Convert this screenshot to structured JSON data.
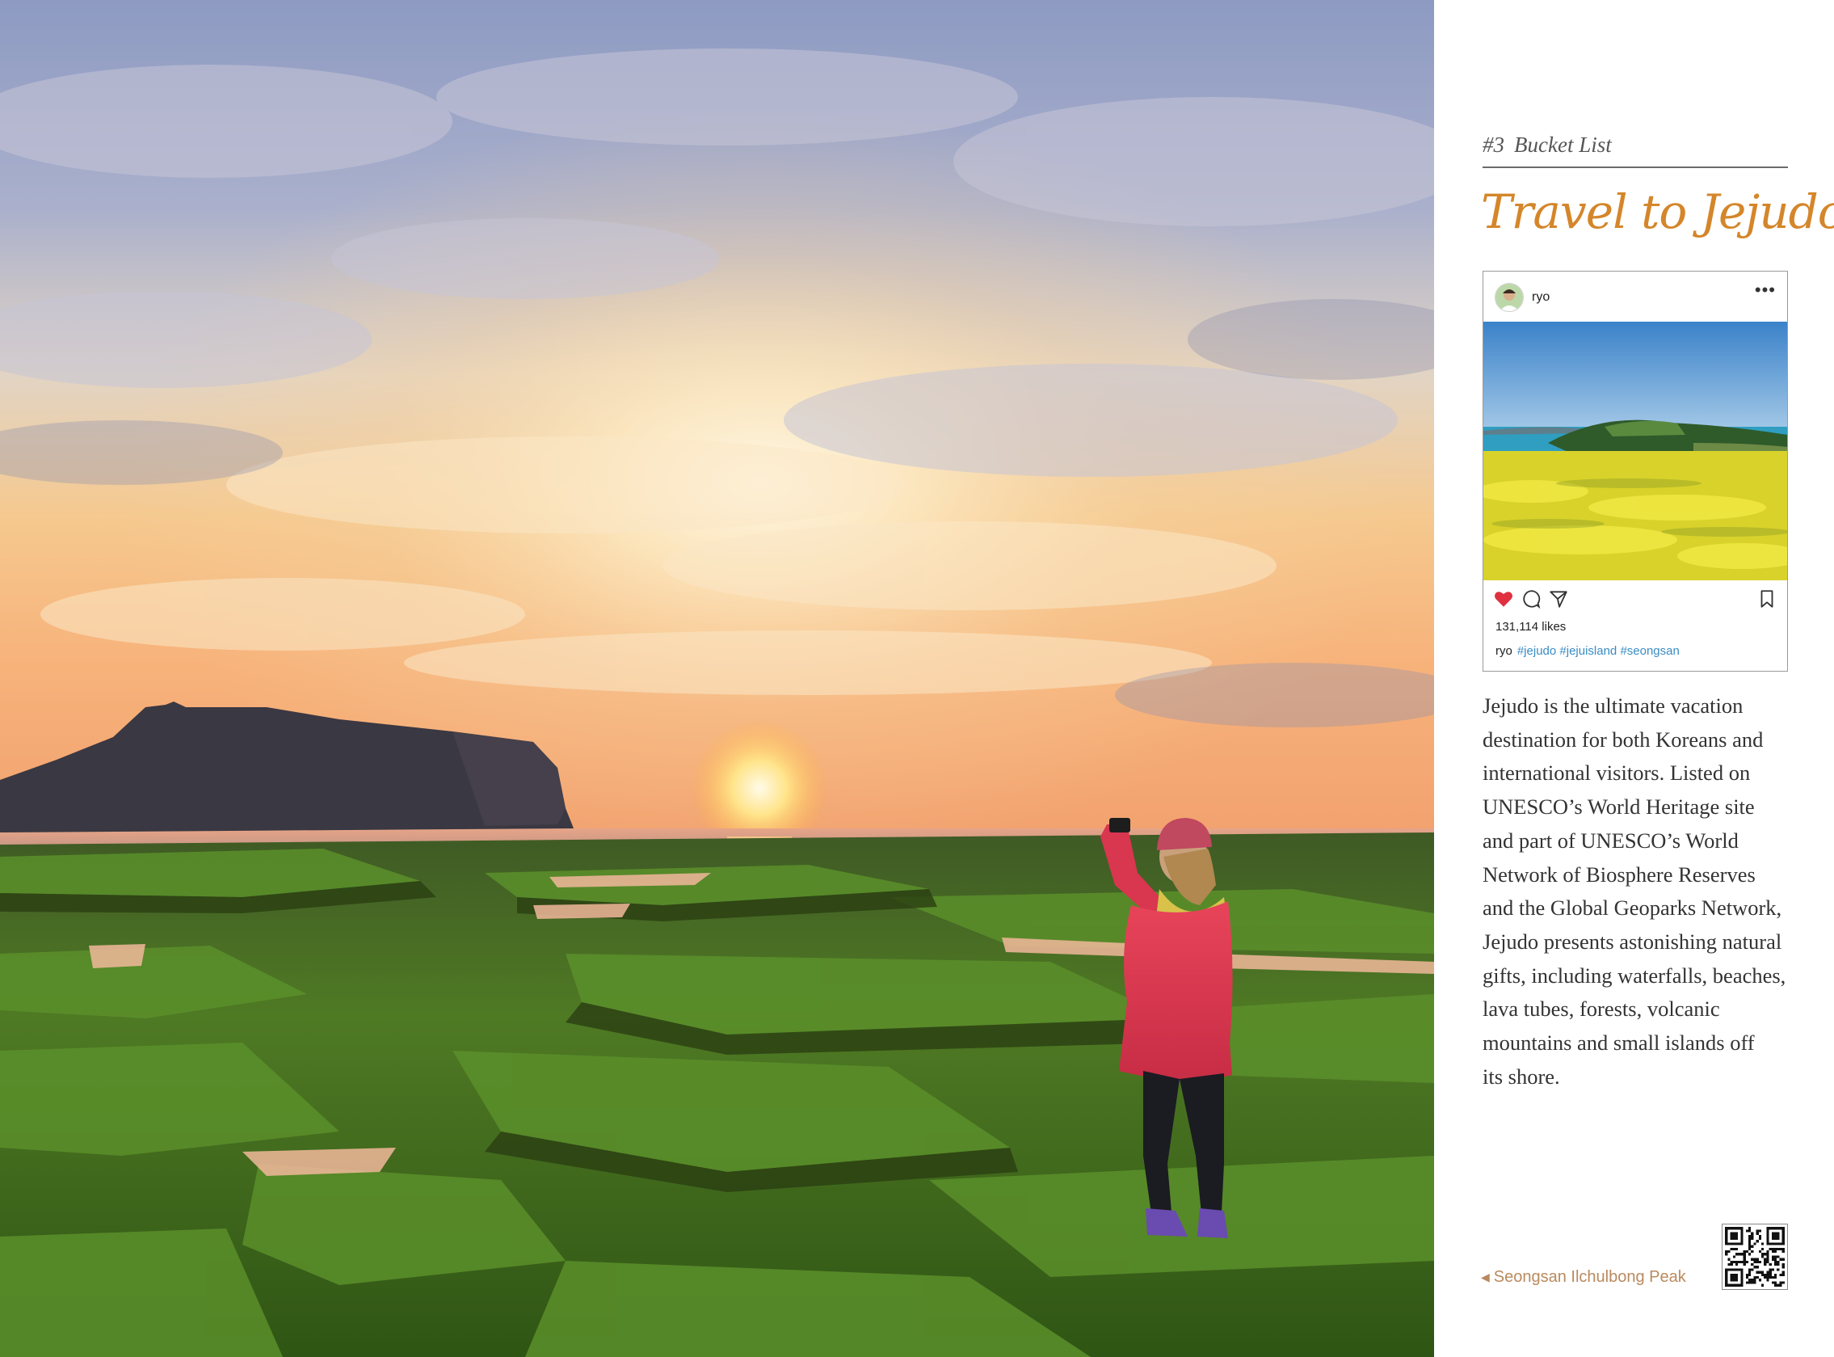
{
  "page": {
    "eyebrow_number": "#3",
    "eyebrow_label": "Bucket List",
    "headline": "Travel to Jejudo"
  },
  "post": {
    "username": "ryo",
    "more_icon": "•••",
    "likes": "131,114 likes",
    "caption_user": "ryo",
    "hashtags": "#jejudo #jejuisland #seongsan",
    "icons": [
      "heart-icon",
      "comment-icon",
      "share-icon",
      "bookmark-icon"
    ],
    "heart_color": "#e0303f"
  },
  "body_lines": [
    "Jejudo is the ultimate vacation",
    "destination for both Koreans and",
    "international visitors. Listed on",
    "UNESCO’s World Heritage site",
    "and part of UNESCO’s World",
    "Network of Biosphere Reserves",
    "and the Global Geoparks Network,",
    "Jejudo presents astonishing natural",
    "gifts, including waterfalls, beaches,",
    "lava tubes, forests, volcanic",
    "mountains and small islands off",
    "its shore."
  ],
  "photo_caption": {
    "arrow": "◀",
    "text": "Seongsan Ilchulbong Peak"
  },
  "colors": {
    "accent": "#d4862a",
    "caption": "#b98a5e",
    "hashtag": "#3a8cc4"
  }
}
